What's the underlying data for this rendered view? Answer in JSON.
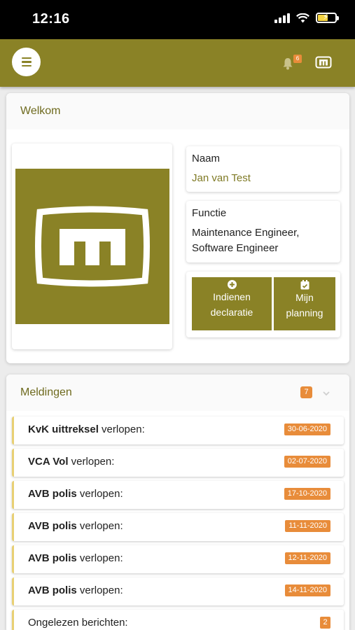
{
  "status_bar": {
    "time": "12:16"
  },
  "app_bar": {
    "notification_count": "6"
  },
  "welcome": {
    "title": "Welkom",
    "naam_label": "Naam",
    "naam_value": "Jan van Test",
    "functie_label": "Functie",
    "functie_value_line1": "Maintenance Engineer,",
    "functie_value_line2": "Software Engineer",
    "actions": {
      "declaratie_line1": "Indienen",
      "declaratie_line2": "declaratie",
      "planning_line1": "Mijn",
      "planning_line2": "planning"
    }
  },
  "meldingen": {
    "title": "Meldingen",
    "count": "7",
    "items": [
      {
        "bold": "KvK uittreksel",
        "text": " verlopen:",
        "badge": "30-06-2020"
      },
      {
        "bold": "VCA Vol",
        "text": " verlopen:",
        "badge": "02-07-2020"
      },
      {
        "bold": "AVB polis",
        "text": " verlopen:",
        "badge": "17-10-2020"
      },
      {
        "bold": "AVB polis",
        "text": " verlopen:",
        "badge": "11-11-2020"
      },
      {
        "bold": "AVB polis",
        "text": " verlopen:",
        "badge": "12-11-2020"
      },
      {
        "bold": "AVB polis",
        "text": " verlopen:",
        "badge": "14-11-2020"
      },
      {
        "bold": "",
        "text": "Ongelezen berichten:",
        "badge": "2"
      }
    ]
  },
  "colors": {
    "brand": "#8a8226",
    "brand_text": "#6e6a1e",
    "badge": "#e88c3a",
    "notif_accent": "#e8d074"
  },
  "icons": {
    "menu": "hamburger-menu-icon",
    "bell": "bell-icon",
    "brand_logo": "mm-logo-icon",
    "declaratie": "plus-circle-icon",
    "planning": "calendar-check-icon",
    "chevron": "chevron-down-icon"
  }
}
